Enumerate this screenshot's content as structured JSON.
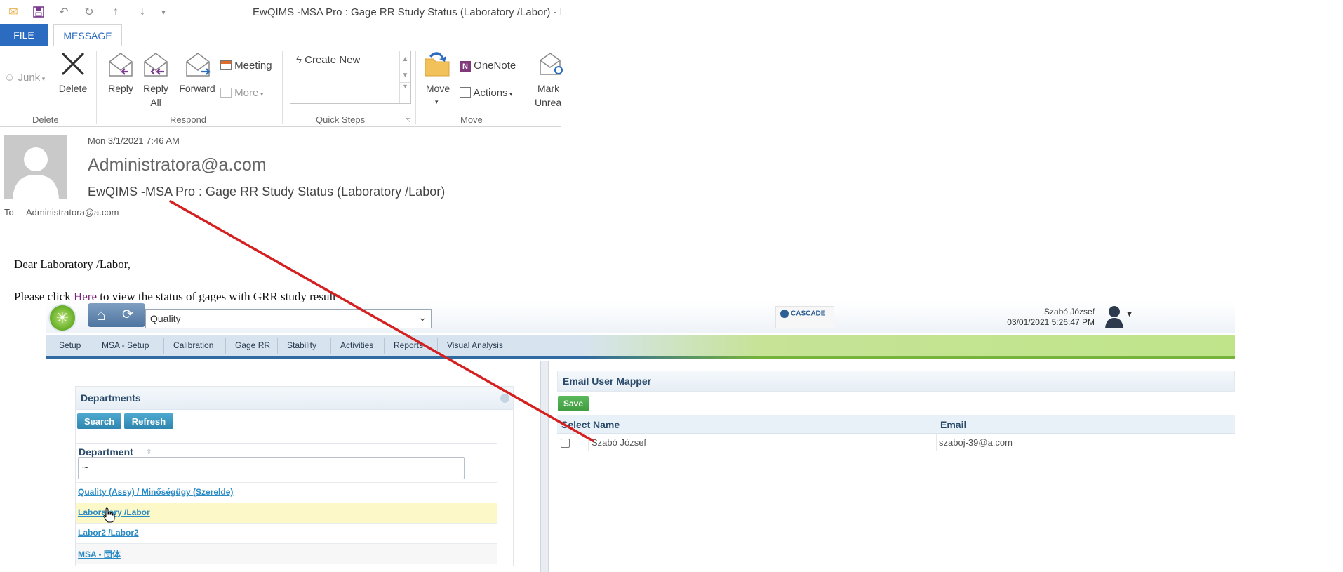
{
  "outlook": {
    "window_title": "EwQIMS -MSA Pro : Gage RR Study Status (Laboratory /Labor) - M",
    "tabs": {
      "file": "FILE",
      "message": "MESSAGE"
    },
    "ribbon": {
      "junk": "Junk",
      "delete": "Delete",
      "reply": "Reply",
      "reply_all_1": "Reply",
      "reply_all_2": "All",
      "forward": "Forward",
      "meeting": "Meeting",
      "more": "More",
      "quick_steps_item": "Create New",
      "move": "Move",
      "onenote": "OneNote",
      "actions": "Actions",
      "mark_1": "Mark",
      "mark_2": "Unrea",
      "group_delete": "Delete",
      "group_respond": "Respond",
      "group_quick_steps": "Quick Steps",
      "group_move": "Move"
    },
    "message": {
      "date": "Mon 3/1/2021 7:46 AM",
      "from": "Administratora@a.com",
      "subject": "EwQIMS -MSA Pro : Gage RR Study Status (Laboratory /Labor)",
      "to_label": "To",
      "to": "Administratora@a.com",
      "greeting": "Dear Laboratory /Labor,",
      "body_pre": "Please click ",
      "body_link": "Here",
      "body_post": " to view the status of gages with GRR study result"
    }
  },
  "app": {
    "module_select": "Quality",
    "cascade_logo": "CASCADE",
    "user_name": "Szabó József",
    "user_datetime": "03/01/2021 5:26:47 PM",
    "nav": [
      "Setup",
      "MSA - Setup",
      "Calibration",
      "Gage RR",
      "Stability",
      "Activities",
      "Reports",
      "Visual Analysis"
    ],
    "departments": {
      "title": "Departments",
      "search": "Search",
      "refresh": "Refresh",
      "column": "Department",
      "filter_value": "~",
      "rows": [
        "Quality (Assy) / Minőségügy (Szerelde)",
        "Laboratory /Labor",
        "Labor2 /Labor2",
        "MSA - 団体"
      ],
      "highlighted_row": 1
    },
    "email_user_mapper": {
      "title": "Email User Mapper",
      "save": "Save",
      "columns": {
        "select": "Select",
        "name": "Name",
        "email": "Email"
      },
      "rows": [
        {
          "name": "Szabó József",
          "email": "szaboj-39@a.com",
          "selected": false
        }
      ]
    }
  },
  "colors": {
    "outlook_accent": "#2b6cc1",
    "annotation_arrow": "#d42020",
    "link_blue": "#2b8bc5",
    "row_highlight": "#fcf8c8",
    "save_green": "#4aa84a"
  }
}
